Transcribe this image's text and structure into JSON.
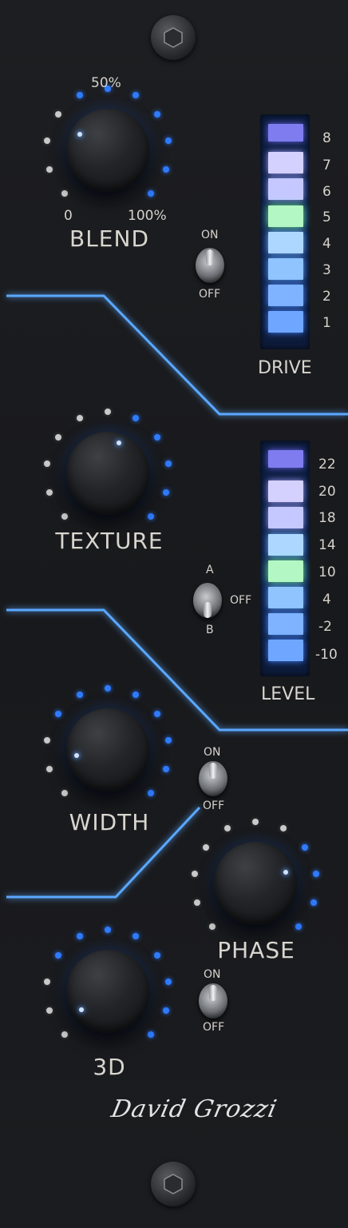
{
  "blend": {
    "label": "BLEND",
    "scale_min": "0",
    "scale_mid": "50%",
    "scale_max": "100%"
  },
  "drive_switch": {
    "on": "ON",
    "off": "OFF"
  },
  "drive_meter": {
    "label": "DRIVE",
    "scale": [
      "8",
      "7",
      "6",
      "5",
      "4",
      "3",
      "2",
      "1"
    ]
  },
  "texture": {
    "label": "TEXTURE"
  },
  "ab_switch": {
    "a": "A",
    "b": "B",
    "off": "OFF"
  },
  "level_meter": {
    "label": "LEVEL",
    "scale": [
      "22",
      "20",
      "18",
      "14",
      "10",
      "4",
      "-2",
      "-10"
    ]
  },
  "width": {
    "label": "WIDTH"
  },
  "width_switch": {
    "on": "ON",
    "off": "OFF"
  },
  "phase": {
    "label": "PHASE"
  },
  "threed": {
    "label": "3D"
  },
  "threed_switch": {
    "on": "ON",
    "off": "OFF"
  },
  "signature": "David Grozzi",
  "colors": {
    "panel": "#1b1c1f",
    "accent_blue": "#2f7bff",
    "wire_glow": "#5aa8ff",
    "label_text": "#d9d5cf"
  }
}
